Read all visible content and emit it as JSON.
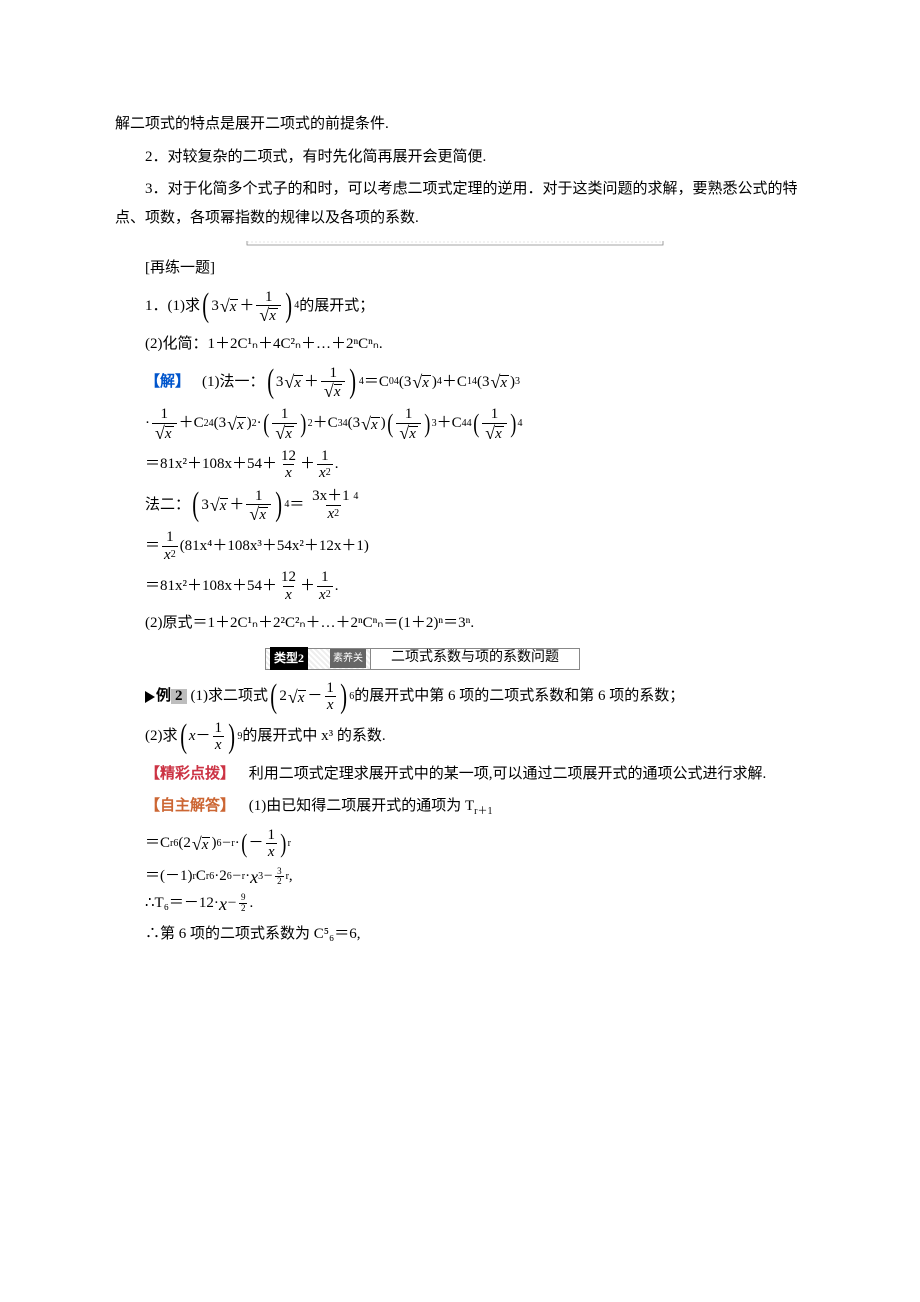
{
  "intro": {
    "line0": "解二项式的特点是展开二项式的前提条件.",
    "line1": "2．对较复杂的二项式，有时先化简再展开会更简便.",
    "line2": "3．对于化简多个式子的和时，可以考虑二项式定理的逆用．对于这类问题的求解，要熟悉公式的特点、项数，各项幂指数的规律以及各项的系数."
  },
  "rehearse": {
    "heading": "[再练一题]",
    "q1_prefix": "1．(1)求",
    "q1_suffix": "的展开式；",
    "q2_line": "(2)化简：1＋2C¹ₙ＋4C²ₙ＋…＋2ⁿCⁿₙ.",
    "sol_label": "【解】",
    "sol1_lead": "(1)法一：",
    "eq_sep": "＝",
    "plus": "＋",
    "dot": "·",
    "result1a": "＝81x²＋108x＋54＋",
    "result1b": "＋",
    "result1c": ".",
    "method2_label": "法二：",
    "m2_mid": "＝",
    "m2_exp": "(81x⁴＋108x³＋54x²＋12x＋1)",
    "sol2_line": "(2)原式＝1＋2C¹ₙ＋2²C²ₙ＋…＋2ⁿCⁿₙ＝(1＋2)ⁿ＝3ⁿ."
  },
  "topic": {
    "left_tag": "类型2",
    "suyang": "素养关",
    "title": "二项式系数与项的系数问题"
  },
  "example2": {
    "badge_text": "例",
    "badge_num": "2",
    "q1_prefix": "(1)求二项式",
    "q1_suffix": "的展开式中第 6 项的二项式系数和第 6 项的系数；",
    "q2_prefix": "(2)求",
    "q2_suffix": "的展开式中 x³ 的系数.",
    "tip_label": "【精彩点拨】",
    "tip_text": "利用二项式定理求展开式中的某一项,可以通过二项展开式的通项公式进行求解.",
    "ans_label": "【自主解答】",
    "ans1_lead": "(1)由已知得二项展开式的通项为 T",
    "ans1_sub": "r＋1",
    "line_t6": "∴T₆＝－12·",
    "t6_exp_base": "x",
    "t6_exp_neg": "－",
    "last_line": "∴第 6 项的二项式系数为 C⁵₆＝6,"
  },
  "sym": {
    "three": "3",
    "x": "x",
    "one": "1",
    "four": "4",
    "C": "C",
    "zero": "0",
    "n1": "1",
    "n2": "2",
    "n3": "3",
    "n4": "4",
    "twelve": "12",
    "eightyone": "81",
    "onezeroeight": "108",
    "fiftyfour": "54",
    "threexplus1": "3x＋1",
    "xsq": "x²",
    "two": "2",
    "six": "6",
    "nine": "9",
    "r": "r",
    "sixminusr": "6－r",
    "minus1": "－1",
    "threehalf": "3",
    "half2": "2",
    "ninehalf": "9",
    "minus": "－"
  }
}
